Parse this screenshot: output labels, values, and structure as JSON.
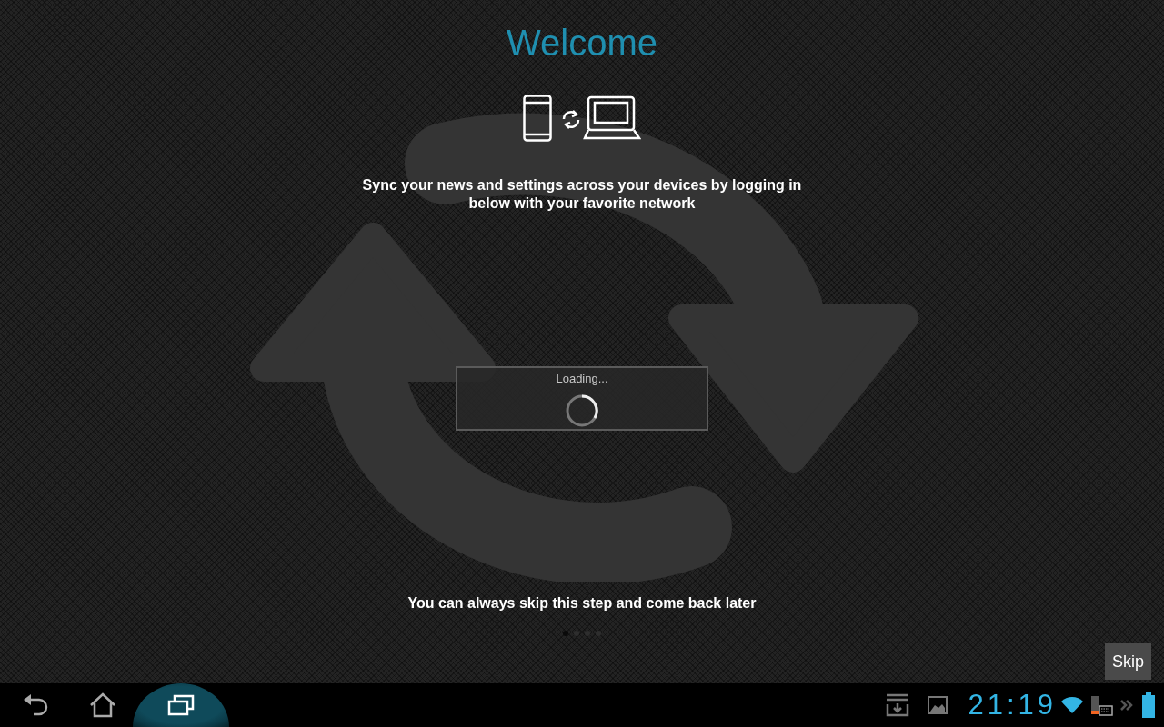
{
  "title": "Welcome",
  "message": "Sync your news and settings across your devices by logging in below with your favorite network",
  "loading": {
    "label": "Loading..."
  },
  "footer_note": "You can always skip this step and come back later",
  "pages": [
    {
      "selected": true
    },
    {
      "selected": false
    },
    {
      "selected": false
    },
    {
      "selected": false
    }
  ],
  "skip_button": "Skip",
  "status_bar": {
    "time": "21:19"
  }
}
